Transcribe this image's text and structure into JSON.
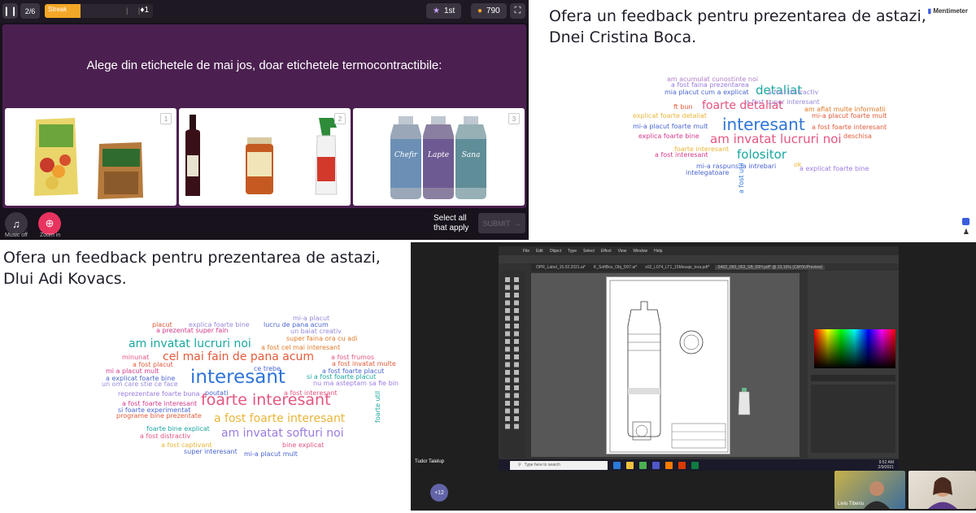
{
  "quiz": {
    "page_counter": "2/6",
    "streak_label": "Streak",
    "streak_count": "1",
    "streak_progress": 0.33,
    "rank": "1st",
    "points": "790",
    "question": "Alege din etichetele de mai jos, doar etichetele termocontractibile:",
    "options": [
      {
        "number": "1",
        "items": [
          "fruit-snack-bag",
          "sugar-pouch"
        ]
      },
      {
        "number": "2",
        "items": [
          "wine-bottle",
          "sauce-jar",
          "spray-bottle"
        ]
      },
      {
        "number": "3",
        "items": [
          "bottle-chefir",
          "bottle-lapte",
          "bottle-sana"
        ],
        "bottle_labels": [
          "Chefir",
          "Lapte",
          "Sana"
        ]
      }
    ],
    "music_label": "Music off",
    "zoom_label": "Zoom in",
    "select_all": [
      "Select all",
      "that apply"
    ],
    "submit": "SUBMIT",
    "colors": {
      "stage": "#4b2050",
      "streak": "#f3a726",
      "zoom": "#e8335f"
    }
  },
  "panel1": {
    "title": [
      "Ofera un feedback pentru prezentarea de astazi,",
      "Dnei Cristina Boca."
    ],
    "brand": "Mentimeter",
    "words": [
      {
        "t": "am acumulat cunostinte noi",
        "c": "#b07fc8",
        "s": 8
      },
      {
        "t": "a fost faina prezentarea",
        "c": "#9a7be0",
        "s": 8
      },
      {
        "t": "detaliat",
        "c": "#1aa6a0",
        "s": 15
      },
      {
        "t": "a fost distractiv",
        "c": "#9a8adb",
        "s": 8
      },
      {
        "t": "mia placut cum a explicat",
        "c": "#4a65d0",
        "s": 8
      },
      {
        "t": "a fost super interesant",
        "c": "#9a8adb",
        "s": 8
      },
      {
        "t": "ft bun",
        "c": "#e25b3a",
        "s": 8
      },
      {
        "t": "foarte detaliat",
        "c": "#e2567f",
        "s": 14
      },
      {
        "t": "am aflat multe informatii",
        "c": "#e07b2a",
        "s": 8
      },
      {
        "t": "explicat foarte detaliat",
        "c": "#e8b53a",
        "s": 8
      },
      {
        "t": "mi-a placut foarte mult",
        "c": "#4a65d0",
        "s": 8
      },
      {
        "t": "interesant",
        "c": "#2e74d8",
        "s": 20
      },
      {
        "t": "mi-a placut foarte mult",
        "c": "#e25b3a",
        "s": 8
      },
      {
        "t": "a fost foarte interesant",
        "c": "#e25b3a",
        "s": 8
      },
      {
        "t": "explica foarte bine",
        "c": "#d43a8a",
        "s": 8
      },
      {
        "t": "am invatat lucruri noi",
        "c": "#e2567f",
        "s": 15
      },
      {
        "t": "deschisa",
        "c": "#e25b3a",
        "s": 8
      },
      {
        "t": "foarte interesant",
        "c": "#e8b53a",
        "s": 8
      },
      {
        "t": "folositor",
        "c": "#1aa6a0",
        "s": 15
      },
      {
        "t": "a fost interesant",
        "c": "#d43a8a",
        "s": 8
      },
      {
        "t": "mi-a raspuns la intrebari",
        "c": "#4a65d0",
        "s": 8
      },
      {
        "t": "ok",
        "c": "#e8b53a",
        "s": 8
      },
      {
        "t": "intelegatoare",
        "c": "#4a65d0",
        "s": 8
      },
      {
        "t": "a explicat foarte bine",
        "c": "#9a7be0",
        "s": 8
      },
      {
        "t": "a fost util",
        "c": "#2e74d8",
        "s": 8,
        "rot": true
      }
    ]
  },
  "panel2": {
    "title": [
      "Ofera un feedback pentru prezentarea de astazi,",
      "Dlui Adi Kovacs."
    ],
    "words": [
      {
        "t": "mi-a placut",
        "c": "#9a8adb",
        "s": 8
      },
      {
        "t": "placut",
        "c": "#e25b3a",
        "s": 8
      },
      {
        "t": "explica foarte bine",
        "c": "#9a8adb",
        "s": 8
      },
      {
        "t": "lucru de pana acum",
        "c": "#4a65d0",
        "s": 8
      },
      {
        "t": "a prezentat super fain",
        "c": "#d43a8a",
        "s": 8
      },
      {
        "t": "un baiat creativ",
        "c": "#9a8adb",
        "s": 8
      },
      {
        "t": "super faina ora cu adi",
        "c": "#e07b2a",
        "s": 8
      },
      {
        "t": "am invatat lucruri noi",
        "c": "#1aa6a0",
        "s": 14
      },
      {
        "t": "a fost cel mai interesant",
        "c": "#e07b2a",
        "s": 8
      },
      {
        "t": "minunat",
        "c": "#e2567f",
        "s": 8
      },
      {
        "t": "cel mai fain de pana acum",
        "c": "#e25b3a",
        "s": 14
      },
      {
        "t": "a fost frumos",
        "c": "#e2567f",
        "s": 8
      },
      {
        "t": "a fost placut",
        "c": "#e25b3a",
        "s": 8
      },
      {
        "t": "a fost invatat multe",
        "c": "#e25b3a",
        "s": 8
      },
      {
        "t": "mi a placut mult",
        "c": "#d43a8a",
        "s": 8
      },
      {
        "t": "ce trebe",
        "c": "#4a65d0",
        "s": 8
      },
      {
        "t": "a fost foarte placut",
        "c": "#4a65d0",
        "s": 8
      },
      {
        "t": "a explicat foarte bine",
        "c": "#4a65d0",
        "s": 8
      },
      {
        "t": "interesant",
        "c": "#2e74d8",
        "s": 23
      },
      {
        "t": "si a fost foarte placut",
        "c": "#1aa6a0",
        "s": 8
      },
      {
        "t": "un om care stie ce face",
        "c": "#9a8adb",
        "s": 8
      },
      {
        "t": "nu ma asteptam sa fie bin",
        "c": "#9a7be0",
        "s": 8
      },
      {
        "t": "reprezentare foarte buna",
        "c": "#9a7be0",
        "s": 8
      },
      {
        "t": "poutati",
        "c": "#4a65d0",
        "s": 8
      },
      {
        "t": "a fost interesant",
        "c": "#e2567f",
        "s": 8
      },
      {
        "t": "a fost foarte interesant",
        "c": "#d43a8a",
        "s": 8
      },
      {
        "t": "foarte interesant",
        "c": "#e2567f",
        "s": 19
      },
      {
        "t": "si foarte experimentat",
        "c": "#4a65d0",
        "s": 8
      },
      {
        "t": "programe bine prezentate",
        "c": "#e25b3a",
        "s": 8
      },
      {
        "t": "a fost foarte interesant",
        "c": "#e8b53a",
        "s": 14
      },
      {
        "t": "foarte util",
        "c": "#1aa6a0",
        "s": 8,
        "rot": true
      },
      {
        "t": "foarte bine explicat",
        "c": "#1aa6a0",
        "s": 8
      },
      {
        "t": "a fost distractiv",
        "c": "#e2567f",
        "s": 8
      },
      {
        "t": "am invatat softuri noi",
        "c": "#9a7be0",
        "s": 14
      },
      {
        "t": "a fost captivant",
        "c": "#e8b53a",
        "s": 8
      },
      {
        "t": "bine explicat",
        "c": "#e2567f",
        "s": 8
      },
      {
        "t": "super interesant",
        "c": "#4a65d0",
        "s": 8
      },
      {
        "t": "mi-a placut mult",
        "c": "#4a65d0",
        "s": 8
      }
    ]
  },
  "meeting": {
    "menu": [
      "File",
      "Edit",
      "Object",
      "Type",
      "Select",
      "Effect",
      "View",
      "Window",
      "Help"
    ],
    "doc_tabs": [
      "OPR_Label_15.02.2021.ai*",
      "K_SoftBox_Obj_D07.ai*",
      "x02_L074_LT1_15Mesaje_tora.pdf*",
      "S402_093_053_SB_00H.pdf* @ 23.16% (CMYK/Preview)"
    ],
    "search_placeholder": "Type here to search",
    "presenter_name": "Tudor Taielup",
    "participants_more": "+12",
    "camera_names": [
      "Liviu Tiberiu",
      ""
    ],
    "clock": [
      "9:52 AM",
      "2/9/2021"
    ],
    "lang": "ENG"
  }
}
